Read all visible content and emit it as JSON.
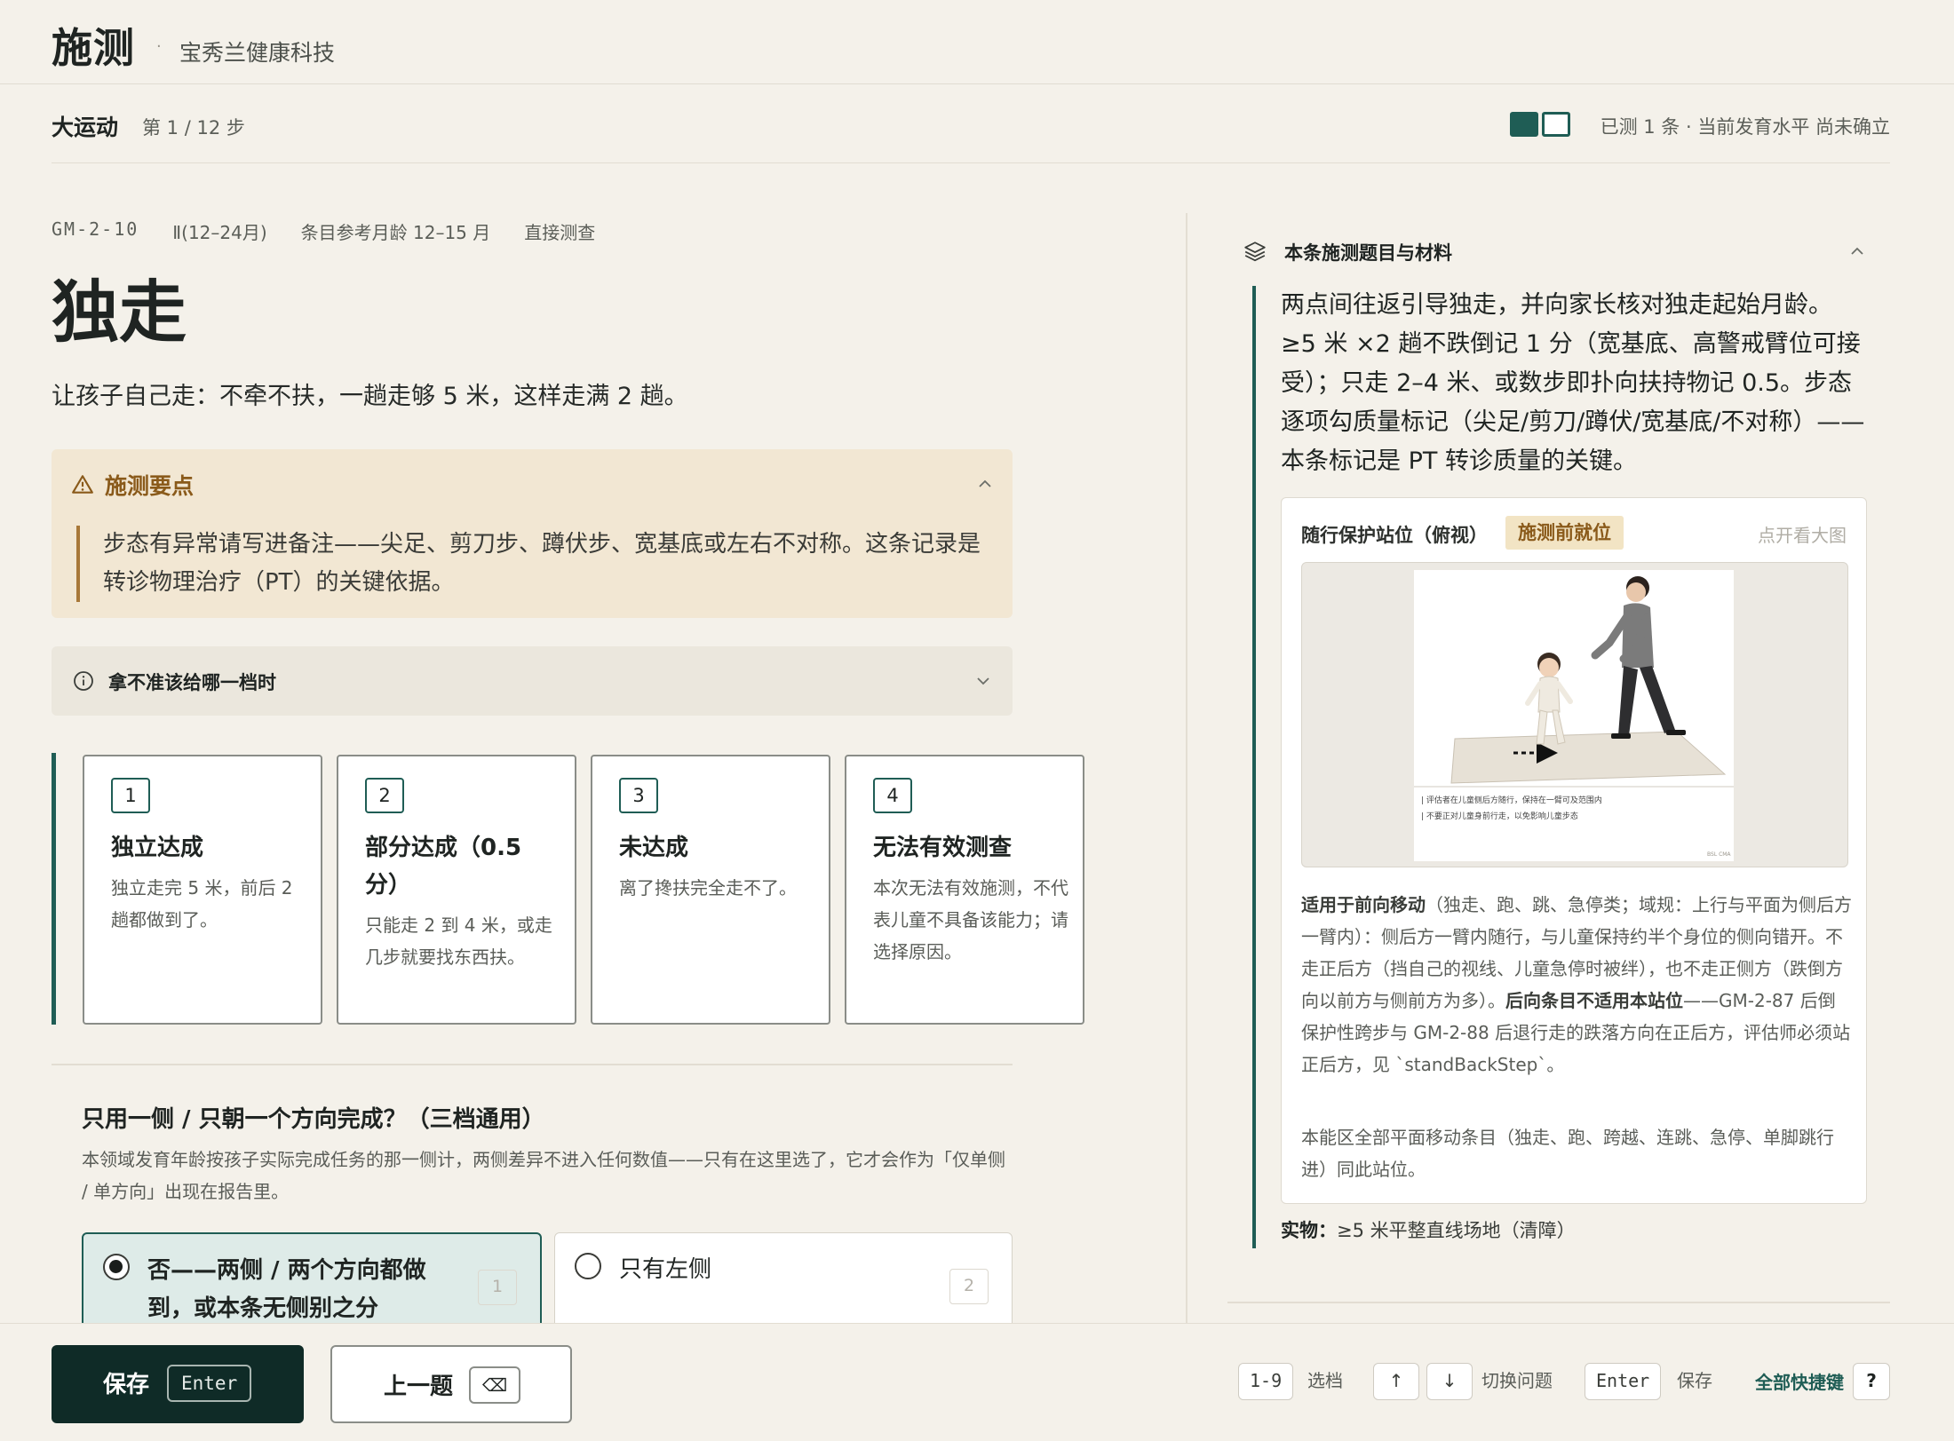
{
  "header": {
    "app_title": "施测",
    "separator": "·",
    "org_name": "宝秀兰健康科技"
  },
  "section": {
    "title": "大运动",
    "step_text": "第 1 / 12 步",
    "progress_text": "已测 1 条 · 当前发育水平 尚未确立",
    "progress_segments": [
      true,
      false
    ]
  },
  "item": {
    "code": "GM-2-10",
    "age_band": "Ⅱ(12–24月)",
    "ref_age": "条目参考月龄 12–15 月",
    "method": "直接测查",
    "title": "独走",
    "instruction": "让孩子自己走：不牵不扶，一趟走够 5 米，这样走满 2 趟。"
  },
  "tips": {
    "title": "施测要点",
    "body": "步态有异常请写进备注——尖足、剪刀步、蹲伏步、宽基底或左右不对称。这条记录是转诊物理治疗（PT）的关键依据。"
  },
  "unsure": {
    "title": "拿不准该给哪一档时"
  },
  "options": [
    {
      "num": "1",
      "title": "独立达成",
      "desc": "独立走完 5 米，前后 2 趟都做到了。"
    },
    {
      "num": "2",
      "title": "部分达成（0.5 分）",
      "desc": "只能走 2 到 4 米，或走几步就要找东西扶。"
    },
    {
      "num": "3",
      "title": "未达成",
      "desc": "离了搀扶完全走不了。"
    },
    {
      "num": "4",
      "title": "无法有效测查",
      "desc": "本次无法有效施测，不代表儿童不具备该能力；请选择原因。"
    }
  ],
  "side_question": {
    "title": "只用一侧 / 只朝一个方向完成？（三档通用）",
    "desc": "本领域发育年龄按孩子实际完成任务的那一侧计，两侧差异不进入任何数值——只有在这里选了，它才会作为「仅单侧 / 单方向」出现在报告里。",
    "choices": [
      {
        "label": "否——两侧 / 两个方向都做到，或本条无侧别之分",
        "key": "1",
        "selected": true
      },
      {
        "label": "只有左侧",
        "key": "2",
        "selected": false
      }
    ]
  },
  "right_panel": {
    "title": "本条施测题目与材料",
    "procedure": "两点间往返引导独走，并向家长核对独走起始月龄。≥5 米 ×2 趟不跌倒记 1 分（宽基底、高警戒臂位可接受）；只走 2–4 米、或数步即扑向扶持物记 0.5。步态逐项勾质量标记（尖足/剪刀/蹲伏/宽基底/不对称）——本条标记是 PT 转诊质量的关键。",
    "card": {
      "title": "随行保护站位（俯视）",
      "tag": "施测前就位",
      "zoom_hint": "点开看大图",
      "figure_caption_1": "| 评估者在儿童侧后方随行，保持在一臂可及范围内",
      "figure_caption_2": "| 不要正对儿童身前行走，以免影响儿童步态",
      "figure_mark": "BSL CMA",
      "p1_bold": "适用于前向移动",
      "p1_a": "（独走、跑、跳、急停类；域规：上行与平面为侧后方一臂内）：侧后方一臂内随行，与儿童保持约半个身位的侧向错开。不走正后方（挡自己的视线、儿童急停时被绊），也不走正侧方（跌倒方向以前方与侧前方为多）。",
      "p1_bold2": "后向条目不适用本站位",
      "p1_b": "——GM-2-87 后倒保护性跨步与 GM-2-88 后退行走的跌落方向在正后方，评估师必须站正后方，见 `standBackStep`。",
      "p2": "本能区全部平面移动条目（独走、跑、跨越、连跳、急停、单脚跳行进）同此站位。"
    },
    "material_label": "实物：",
    "material_text": "≥5 米平整直线场地（清障）"
  },
  "footer": {
    "save_label": "保存",
    "save_key": "Enter",
    "prev_label": "上一题",
    "prev_key": "⌫",
    "hotkeys": {
      "select_key": "1-9",
      "select_label": "选档",
      "up_key": "↑",
      "down_key": "↓",
      "switch_label": "切换问题",
      "save_key": "Enter",
      "save_label": "保存",
      "all_label": "全部快捷键",
      "help_key": "?"
    }
  },
  "colors": {
    "accent": "#1f5d55",
    "warning": "#8a5a1a",
    "background": "#f4f1ea"
  }
}
